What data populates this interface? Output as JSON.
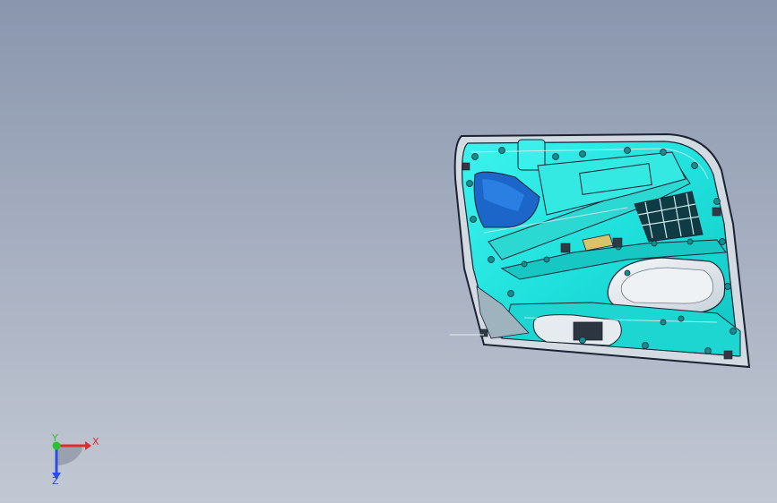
{
  "viewport": {
    "background_top": "#8996ad",
    "background_bottom": "#c2c8d3"
  },
  "model": {
    "part_name": "door-trim-panel",
    "primary_color": "#1fe6e0",
    "shade_color": "#0fb5b3",
    "edge_color": "#1a2233",
    "highlight_color": "#e8ecef",
    "accent_color": "#d9c36a"
  },
  "triad": {
    "x_label": "X",
    "y_label": "Y",
    "z_label": "Z",
    "x_color": "#e22b2b",
    "y_color": "#28c42b",
    "z_color": "#2b4fe0"
  }
}
